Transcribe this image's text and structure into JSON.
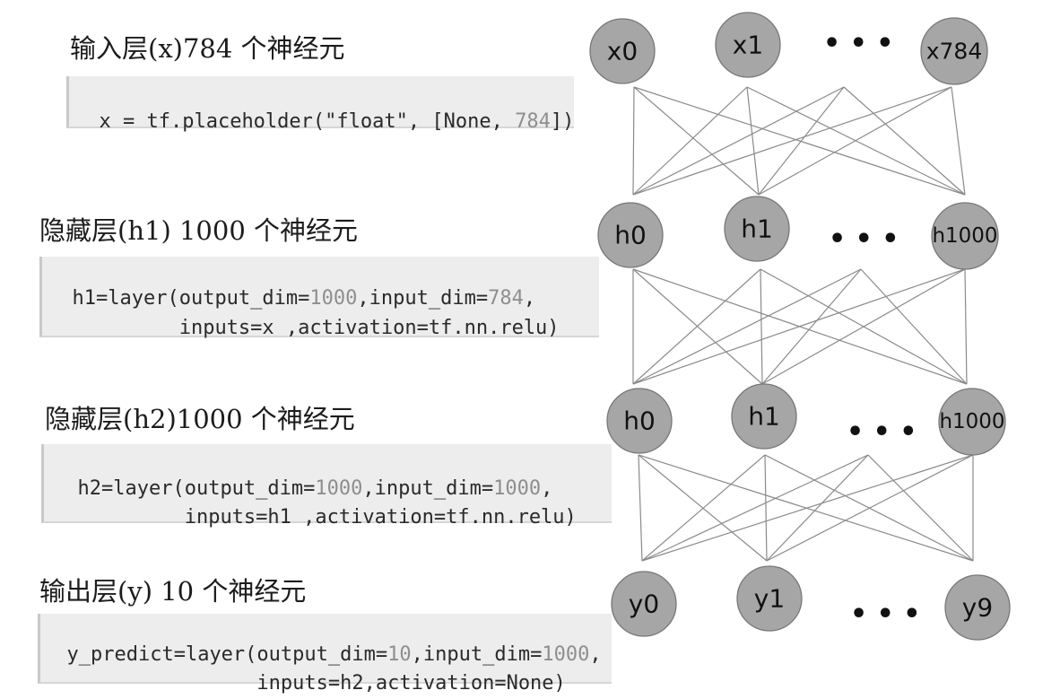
{
  "layers": [
    {
      "heading": "输入层(x)784 个神经元",
      "code_line1": [
        "x = tf.placeholder(\"float\", [None, ",
        "784",
        "])"
      ],
      "code_line2": [],
      "nodes": [
        "x0",
        "x1",
        "x784"
      ]
    },
    {
      "heading": "隐藏层(h1) 1000 个神经元",
      "code_line1": [
        "h1=layer(output_dim=",
        "1000",
        ",input_dim=",
        "784",
        ","
      ],
      "code_line2": [
        "         inputs=x ,activation=tf.nn.relu)"
      ],
      "nodes": [
        "h0",
        "h1",
        "h1000"
      ]
    },
    {
      "heading": "隐藏层(h2)1000 个神经元",
      "code_line1": [
        "h2=layer(output_dim=",
        "1000",
        ",input_dim=",
        "1000",
        ","
      ],
      "code_line2": [
        "         inputs=h1 ,activation=tf.nn.relu)"
      ],
      "nodes": [
        "h0",
        "h1",
        "h1000"
      ]
    },
    {
      "heading": "输出层(y) 10 个神经元",
      "code_line1": [
        "y_predict=layer(output_dim=",
        "10",
        ",input_dim=",
        "1000",
        ","
      ],
      "code_line2": [
        "                inputs=h2,activation=None)"
      ],
      "nodes": [
        "y0",
        "y1",
        "y9"
      ]
    }
  ],
  "ellipsis": "• • •",
  "colors": {
    "node_fill": "#a6a6a6",
    "edge": "#8a8a8a",
    "code_bg": "#ededed",
    "code_number": "#8e8e8e"
  }
}
